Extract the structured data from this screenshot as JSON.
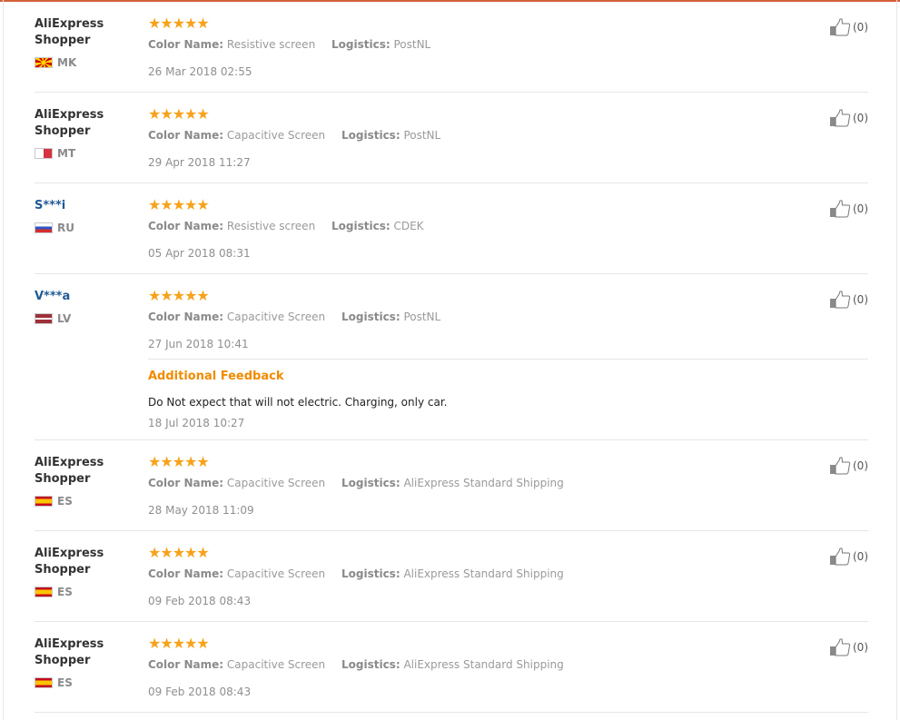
{
  "reviews": [
    {
      "name": "AliExpress\nShopper",
      "masked": false,
      "country": "MK",
      "flag": "mk",
      "stars": "★★★★★",
      "color_label": "Color Name:",
      "color_value": "Resistive screen",
      "logistics_label": "Logistics:",
      "logistics_value": "PostNL",
      "date": "26 Mar 2018 02:55",
      "helpful": "(0)"
    },
    {
      "name": "AliExpress\nShopper",
      "masked": false,
      "country": "MT",
      "flag": "mt",
      "stars": "★★★★★",
      "color_label": "Color Name:",
      "color_value": "Capacitive Screen",
      "logistics_label": "Logistics:",
      "logistics_value": "PostNL",
      "date": "29 Apr 2018 11:27",
      "helpful": "(0)"
    },
    {
      "name": "S***i",
      "masked": true,
      "country": "RU",
      "flag": "ru",
      "stars": "★★★★★",
      "color_label": "Color Name:",
      "color_value": "Resistive screen",
      "logistics_label": "Logistics:",
      "logistics_value": "CDEK",
      "date": "05 Apr 2018 08:31",
      "helpful": "(0)"
    },
    {
      "name": "V***a",
      "masked": true,
      "country": "LV",
      "flag": "lv",
      "stars": "★★★★★",
      "color_label": "Color Name:",
      "color_value": "Capacitive Screen",
      "logistics_label": "Logistics:",
      "logistics_value": "PostNL",
      "date": "27 Jun 2018 10:41",
      "helpful": "(0)",
      "additional": {
        "title": "Additional Feedback",
        "text": "Do Not expect that will not electric. Charging, only car.",
        "date": "18 Jul 2018 10:27"
      }
    },
    {
      "name": "AliExpress\nShopper",
      "masked": false,
      "country": "ES",
      "flag": "es",
      "stars": "★★★★★",
      "color_label": "Color Name:",
      "color_value": "Capacitive Screen",
      "logistics_label": "Logistics:",
      "logistics_value": "AliExpress Standard Shipping",
      "date": "28 May 2018 11:09",
      "helpful": "(0)"
    },
    {
      "name": "AliExpress\nShopper",
      "masked": false,
      "country": "ES",
      "flag": "es",
      "stars": "★★★★★",
      "color_label": "Color Name:",
      "color_value": "Capacitive Screen",
      "logistics_label": "Logistics:",
      "logistics_value": "AliExpress Standard Shipping",
      "date": "09 Feb 2018 08:43",
      "helpful": "(0)"
    },
    {
      "name": "AliExpress\nShopper",
      "masked": false,
      "country": "ES",
      "flag": "es",
      "stars": "★★★★★",
      "color_label": "Color Name:",
      "color_value": "Capacitive Screen",
      "logistics_label": "Logistics:",
      "logistics_value": "AliExpress Standard Shipping",
      "date": "09 Feb 2018 08:43",
      "helpful": "(0)"
    }
  ],
  "icons": {
    "rating": "star-icon",
    "helpful": "thumbs-up-icon"
  },
  "colors": {
    "accent_line": "#d4603a",
    "star": "#f7a21a",
    "masked_name": "#1f5a96",
    "additional_title": "#f18b00"
  }
}
